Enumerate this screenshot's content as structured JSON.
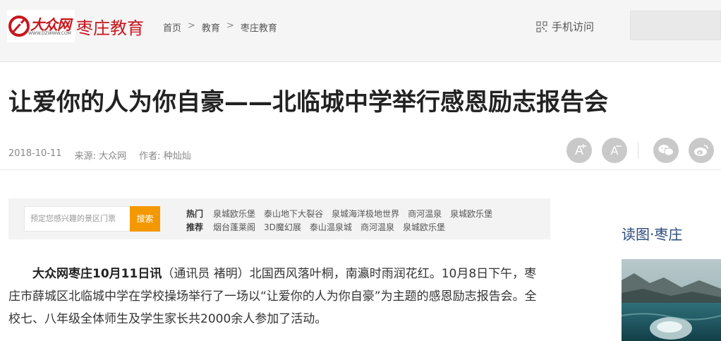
{
  "header": {
    "logo_text": "大众网",
    "logo_url_text": "WWW.DZWWW.COM",
    "channel": "枣庄教育",
    "breadcrumb": [
      "首页",
      "教育",
      "枣庄教育"
    ],
    "breadcrumb_sep": ">",
    "mobile_label": "手机访问"
  },
  "article": {
    "title": "让爱你的人为你自豪——北临城中学举行感恩励志报告会",
    "date": "2018-10-11",
    "source": "来源: 大众网",
    "author": "作者: 种灿灿",
    "lead": "大众网枣庄10月11日讯",
    "body": "（通讯员 褚明）北国西风落叶桐，南瀛时雨润花红。10月8日下午，枣庄市薛城区北临城中学在学校操场举行了一场以“让爱你的人为你自豪”为主题的感恩励志报告会。全校七、八年级全体师生及学生家长共2000余人参加了活动。"
  },
  "tools": {
    "font_increase": "A",
    "font_decrease": "A"
  },
  "ad": {
    "placeholder": "预定您感兴趣的景区门票",
    "button": "搜索",
    "hot_label": "热门",
    "hot": [
      "泉城欧乐堡",
      "泰山地下大裂谷",
      "泉城海洋极地世界",
      "商河温泉",
      "泉城欧乐堡"
    ],
    "rec_label": "推荐",
    "rec": [
      "烟台蓬莱阁",
      "3D魔幻展",
      "泰山温泉城",
      "商河温泉",
      "泉城欧乐堡"
    ]
  },
  "sidebar": {
    "title": "读图·枣庄"
  },
  "colors": {
    "brand_red": "#c8161d",
    "accent_orange": "#f39800",
    "sidebar_blue": "#2a4a7a"
  }
}
